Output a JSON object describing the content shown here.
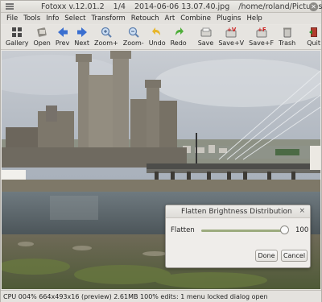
{
  "window": {
    "title_app": "Fotoxx v.12.01.2",
    "title_index": "1/4",
    "title_file": "2014-06-06 13.07.40.jpg",
    "title_path": "/home/roland/Pictures/"
  },
  "menu": [
    "File",
    "Tools",
    "Info",
    "Select",
    "Transform",
    "Retouch",
    "Art",
    "Combine",
    "Plugins",
    "Help"
  ],
  "toolbar": [
    {
      "label": "Gallery",
      "icon": "gallery-icon"
    },
    {
      "label": "Open",
      "icon": "open-icon"
    },
    {
      "label": "Prev",
      "icon": "prev-arrow-icon"
    },
    {
      "label": "Next",
      "icon": "next-arrow-icon"
    },
    {
      "label": "Zoom+",
      "icon": "zoom-in-icon"
    },
    {
      "label": "Zoom-",
      "icon": "zoom-out-icon"
    },
    {
      "label": "Undo",
      "icon": "undo-icon"
    },
    {
      "label": "Redo",
      "icon": "redo-icon"
    },
    {
      "label": "Save",
      "icon": "save-icon"
    },
    {
      "label": "Save+V",
      "icon": "save-version-icon"
    },
    {
      "label": "Save+F",
      "icon": "save-file-icon"
    },
    {
      "label": "Trash",
      "icon": "trash-icon"
    },
    {
      "label": "Quit",
      "icon": "quit-icon"
    }
  ],
  "dialog": {
    "title": "Flatten Brightness Distribution",
    "close_glyph": "×",
    "slider_label": "Flatten",
    "slider_value": "100",
    "slider_fraction": 1.0,
    "done_label": "Done",
    "cancel_label": "Cancel"
  },
  "status": {
    "text": "CPU 004%   664x493x16 (preview) 2.61MB 100%   edits: 1   menu locked   dialog open"
  },
  "colors": {
    "slider_fill": "#9cab7e",
    "prev_next": "#3a6fd0",
    "undo": "#e7b62a",
    "redo": "#4fae3a",
    "save_red": "#cc2020"
  }
}
